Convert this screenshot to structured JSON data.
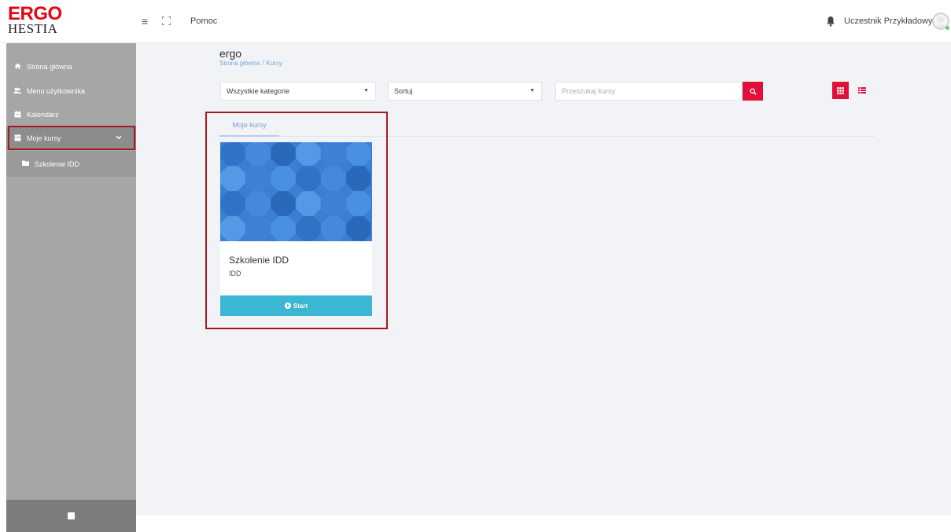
{
  "brand": {
    "line1": "ERGO",
    "line2": "HESTIA",
    "color": "#e30613"
  },
  "topbar": {
    "help_label": "Pomoc",
    "user_name": "Uczestnik Przykładowy",
    "icons": [
      "menu-icon",
      "fullscreen-icon",
      "bell-icon",
      "avatar"
    ]
  },
  "sidebar": {
    "items": [
      {
        "label": "Strona główna",
        "icon": "home-icon"
      },
      {
        "label": "Menu użytkownika",
        "icon": "user-menu-icon"
      },
      {
        "label": "Kalendarz",
        "icon": "calendar-icon"
      },
      {
        "label": "Moje kursy",
        "icon": "courses-icon",
        "expanded": true
      },
      {
        "label": "Szkolenie IDD",
        "icon": "folder-icon"
      }
    ]
  },
  "page": {
    "title": "ergo",
    "breadcrumb": [
      "Strona główna",
      "Kursy"
    ]
  },
  "filters": {
    "category_value": "Wszystkie kategorie",
    "sort_value": "Sortuj",
    "search_placeholder": "Przeszukaj kursy"
  },
  "tabs": [
    {
      "label": "Moje kursy",
      "active": true
    }
  ],
  "courses": [
    {
      "title": "Szkolenie IDD",
      "subtitle": "IDD",
      "button_label": "Start"
    }
  ],
  "colors": {
    "accent_red": "#e0103a",
    "start_button": "#3bb6d3",
    "highlight_outline": "#a8191f",
    "sidebar_bg": "#a6a6a6"
  }
}
